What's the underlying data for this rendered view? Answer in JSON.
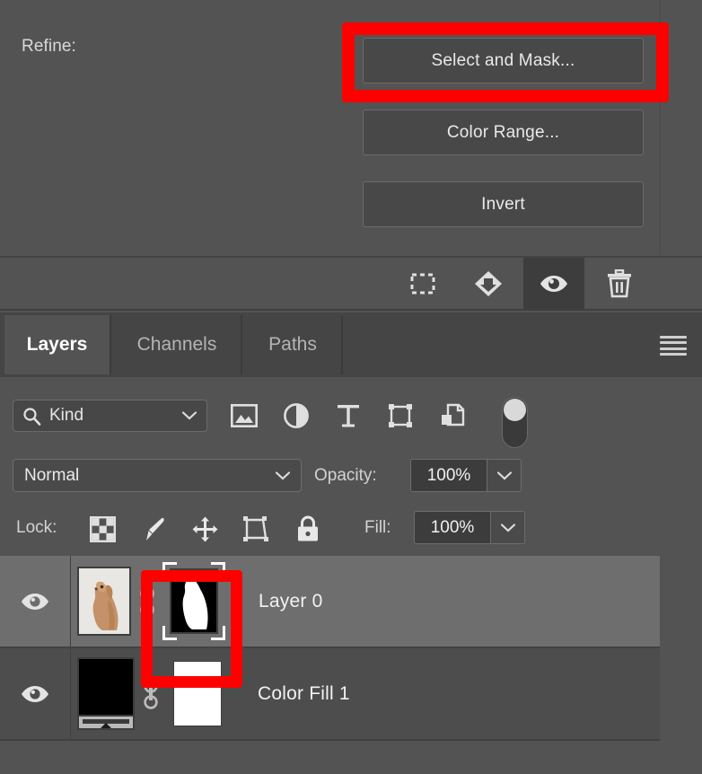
{
  "refine": {
    "label": "Refine:",
    "buttons": [
      {
        "name": "select-and-mask",
        "label": "Select and Mask..."
      },
      {
        "name": "color-range",
        "label": "Color Range..."
      },
      {
        "name": "invert",
        "label": "Invert"
      }
    ]
  },
  "annotations": {
    "color": "#ff0000",
    "boxes": [
      {
        "target": "select-and-mask-button"
      },
      {
        "target": "layer-mask-thumbnail"
      }
    ]
  },
  "action_bar": {
    "icons": [
      {
        "name": "select-pixels-icon",
        "title": "Load channel as selection",
        "active": false
      },
      {
        "name": "load-selection-icon",
        "title": "Save selection as channel",
        "active": false
      },
      {
        "name": "visibility-eye-icon",
        "title": "Toggle visibility",
        "active": true
      },
      {
        "name": "trash-icon",
        "title": "Delete",
        "active": false
      }
    ]
  },
  "panel": {
    "tabs": [
      {
        "label": "Layers",
        "active": true
      },
      {
        "label": "Channels",
        "active": false
      },
      {
        "label": "Paths",
        "active": false
      }
    ],
    "menu_icon": "hamburger-menu-icon"
  },
  "filter": {
    "search_icon": "search-icon",
    "kind_value": "Kind",
    "chevron": "chevron-down-icon",
    "type_icons": [
      {
        "name": "pixel-layer-filter-icon"
      },
      {
        "name": "adjustment-layer-filter-icon"
      },
      {
        "name": "type-layer-filter-icon"
      },
      {
        "name": "shape-layer-filter-icon"
      },
      {
        "name": "smart-object-filter-icon"
      }
    ],
    "toggle_name": "filter-enable-toggle"
  },
  "blend": {
    "mode": "Normal",
    "opacity_label": "Opacity:",
    "opacity_value": "100%"
  },
  "lock": {
    "label": "Lock:",
    "icons": [
      {
        "name": "lock-transparency-icon"
      },
      {
        "name": "lock-image-pixels-icon"
      },
      {
        "name": "lock-position-icon"
      },
      {
        "name": "lock-artboard-nesting-icon"
      },
      {
        "name": "lock-all-icon"
      }
    ],
    "fill_label": "Fill:",
    "fill_value": "100%"
  },
  "layers": [
    {
      "name": "Layer 0",
      "visible": true,
      "selected": true,
      "thumbnail": "dog-photo-thumbnail",
      "linked": true,
      "mask": "dog-silhouette-layer-mask",
      "mask_selected": true
    },
    {
      "name": "Color Fill 1",
      "visible": true,
      "selected": false,
      "thumbnail": "black-color-fill-swatch",
      "linked": true,
      "mask": "white-layer-mask",
      "mask_selected": false
    }
  ]
}
